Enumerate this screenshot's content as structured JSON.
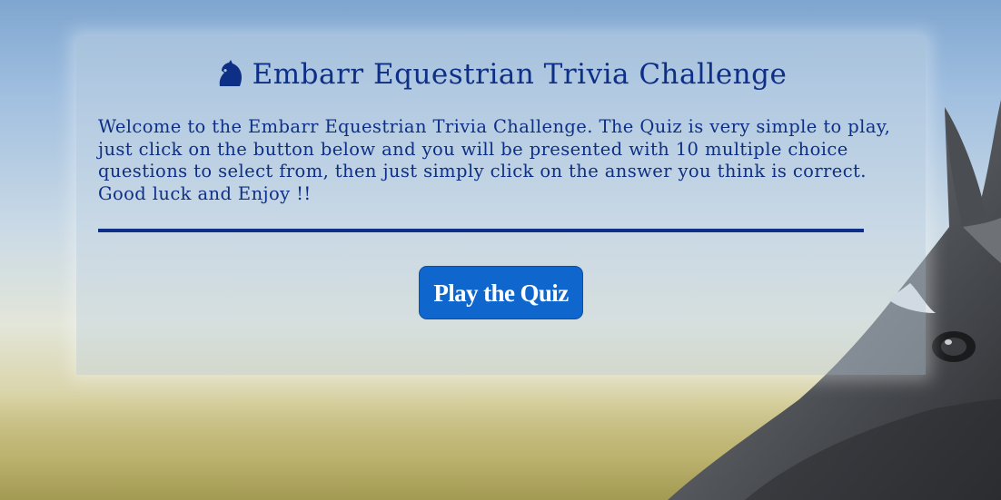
{
  "header": {
    "icon": "horse-head-icon",
    "title": "Embarr Equestrian Trivia Challenge"
  },
  "intro": {
    "text": "Welcome to the Embarr Equestrian Trivia Challenge. The Quiz is very simple to play, just click on the button below and you will be presented with 10 multiple choice questions to select from, then just simply click on the answer you think is correct. Good luck and Enjoy !!"
  },
  "actions": {
    "play_label": "Play the Quiz"
  },
  "colors": {
    "title_text": "#0e2f86",
    "button_bg": "#0f66cc",
    "button_text": "#ffffff"
  },
  "background": {
    "image": "horse-head-photo"
  }
}
